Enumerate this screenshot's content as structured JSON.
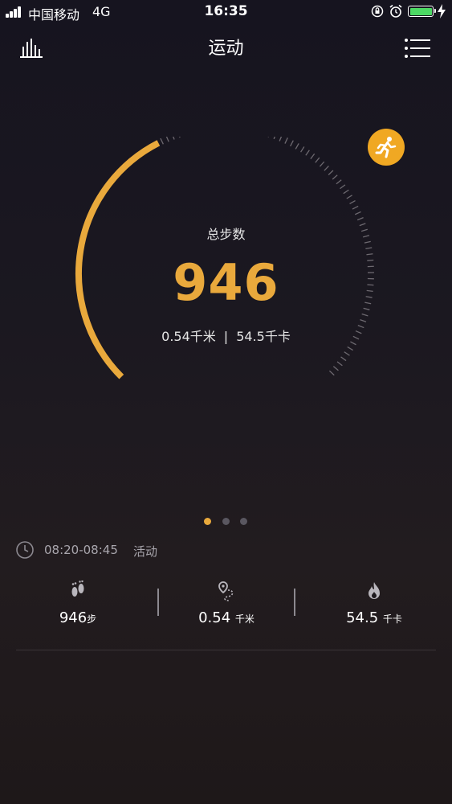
{
  "status_bar": {
    "carrier": "中国移动",
    "network": "4G",
    "time": "16:35",
    "battery_color": "#4cd964"
  },
  "header": {
    "title": "运动",
    "left_icon": "bar-chart-icon",
    "right_icon": "menu-icon"
  },
  "badge": {
    "icon": "running-person-icon",
    "color": "#f0a823"
  },
  "gauge": {
    "label": "总步数",
    "steps": "946",
    "distance_text": "0.54千米",
    "separator": "|",
    "calories_text": "54.5千卡",
    "progress": 0.4,
    "accent_color": "#e9a93c"
  },
  "pager": {
    "count": 3,
    "active_index": 0
  },
  "activity": {
    "time_range": "08:20-08:45",
    "type": "活动"
  },
  "stats": [
    {
      "icon": "footprints-icon",
      "value": "946",
      "unit": "步"
    },
    {
      "icon": "route-icon",
      "value": "0.54",
      "unit": "千米"
    },
    {
      "icon": "flame-icon",
      "value": "54.5",
      "unit": "千卡"
    }
  ]
}
